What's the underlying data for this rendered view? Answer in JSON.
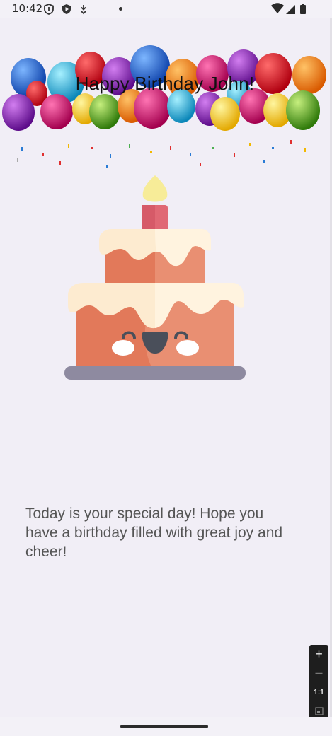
{
  "status_bar": {
    "time": "10:42",
    "left_icons": [
      "shield-icon",
      "play-store-icon",
      "download-icon"
    ],
    "right_icons": [
      "wifi-icon",
      "cell-signal-icon",
      "battery-icon"
    ]
  },
  "banner": {
    "title": "Happy Birthday John!"
  },
  "message": "Today is your special day! Hope you have a birthday filled with great joy and cheer!",
  "zoom_controls": {
    "zoom_in": "+",
    "zoom_out": "–",
    "reset": "1:1",
    "fit_icon": "fit-screen-icon"
  },
  "colors": {
    "background": "#f1eef6",
    "cake_body": "#e2795a",
    "frosting": "#fdebd0",
    "plate": "#8e8aa0",
    "candle": "#e06874",
    "flame": "#f7ec98"
  }
}
